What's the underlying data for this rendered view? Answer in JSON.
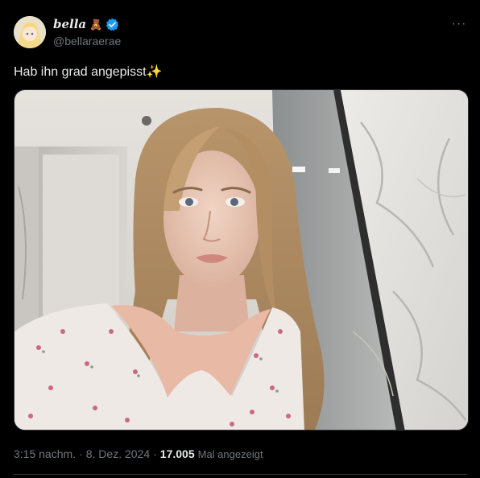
{
  "author": {
    "display_name": "bella",
    "display_emoji": "🧸",
    "handle": "@bellaraerae",
    "verified": true
  },
  "menu": {
    "more_label": "···"
  },
  "tweet": {
    "text": "Hab ihn grad angepisst✨",
    "time": "3:15 nachm.",
    "separator": "·",
    "date": "8. Dez. 2024",
    "views_count": "17.005",
    "views_label": "Mal angezeigt"
  },
  "colors": {
    "background": "#000000",
    "text_primary": "#e7e9ea",
    "text_secondary": "#71767b",
    "verified_badge": "#1d9bf0",
    "border": "#2f3336"
  },
  "icons": [
    "avatar",
    "teddy-bear-emoji",
    "verified-badge-icon",
    "more-options-icon",
    "sparkles-emoji"
  ]
}
